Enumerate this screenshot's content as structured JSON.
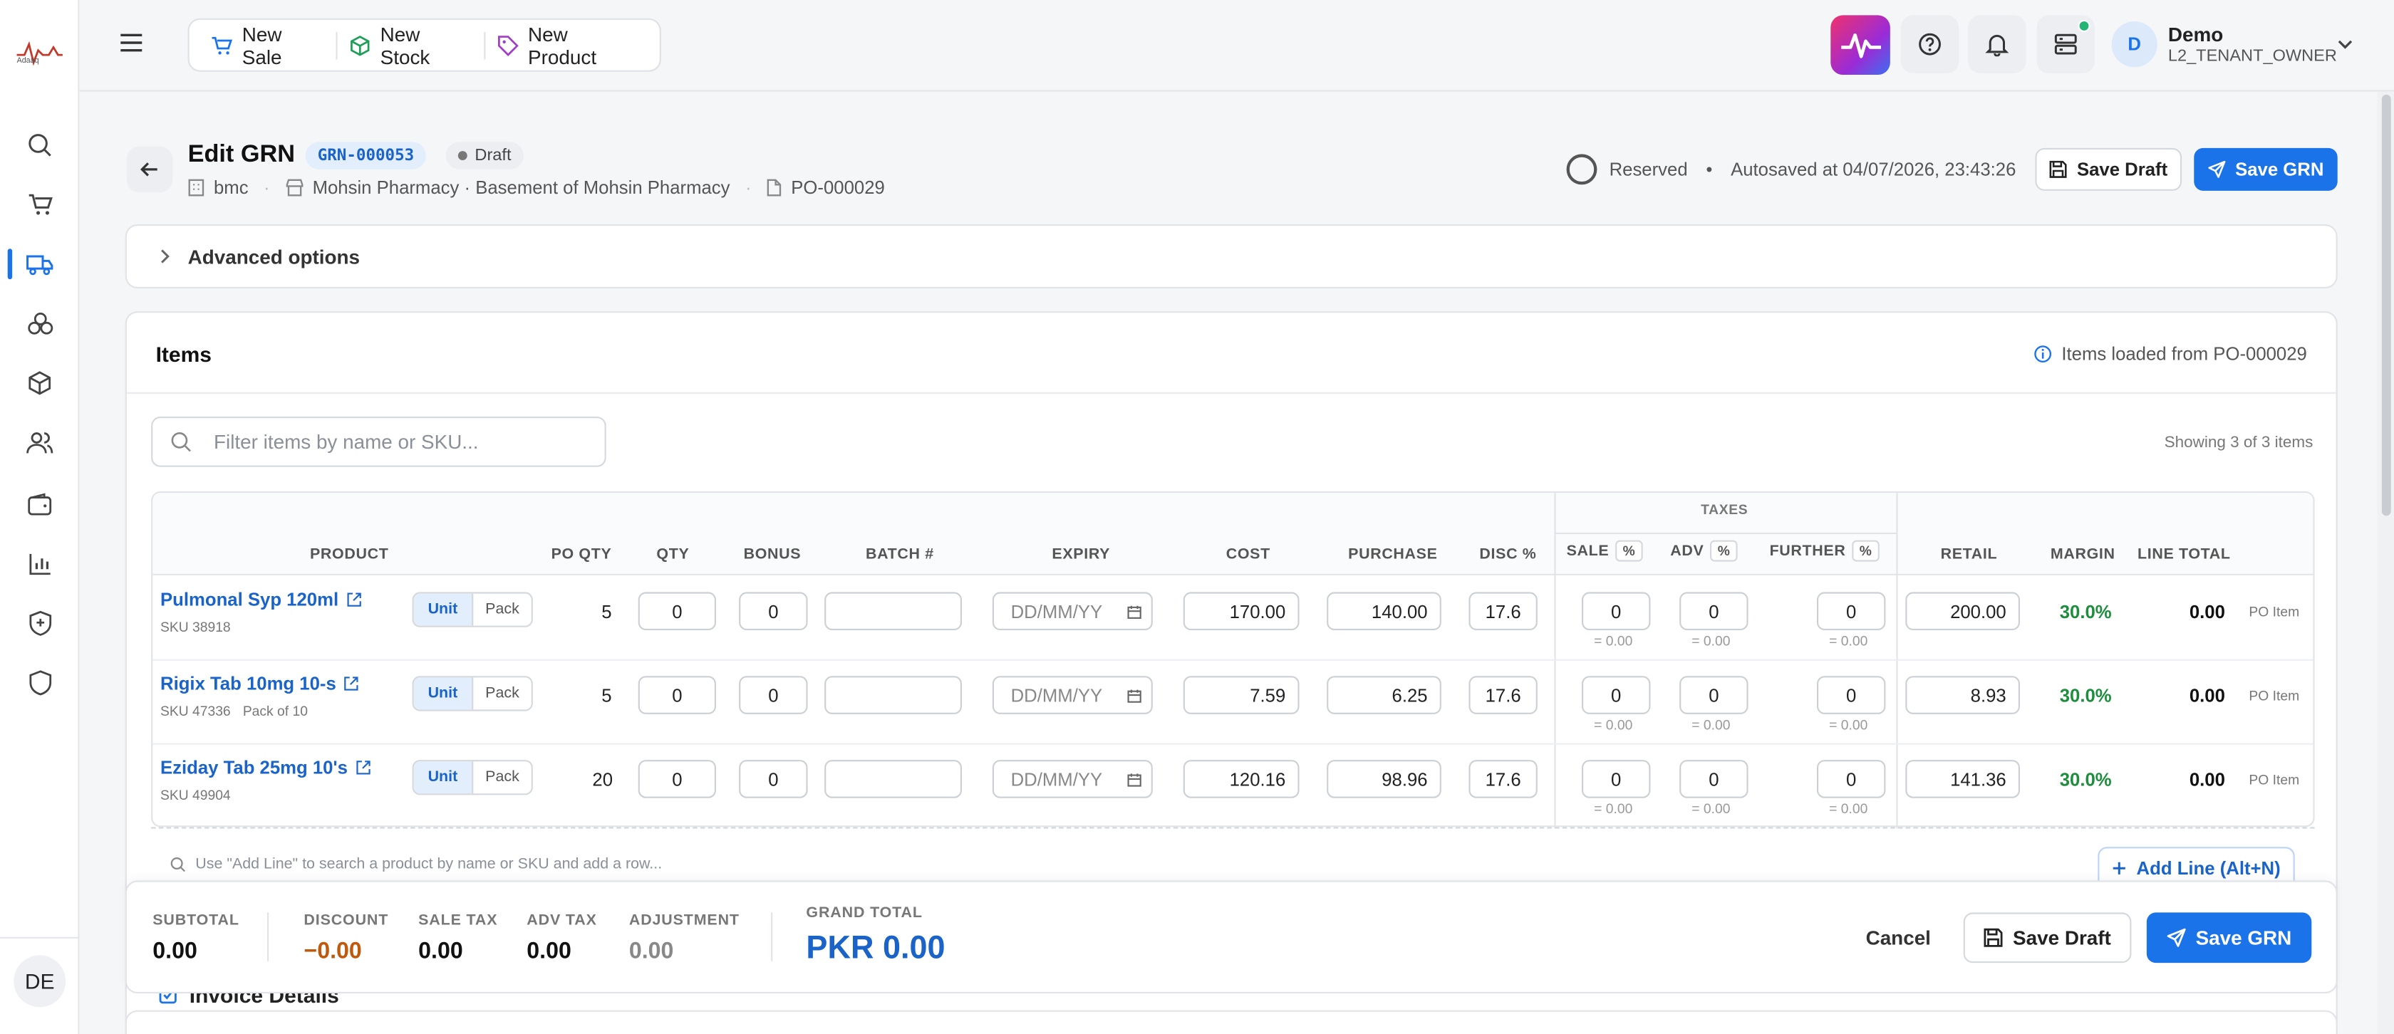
{
  "app": {
    "logo_text": "Adaaq"
  },
  "topbar": {
    "quick_actions": [
      {
        "label": "New Sale",
        "icon": "cart-icon"
      },
      {
        "label": "New Stock",
        "icon": "box-plus-icon"
      },
      {
        "label": "New Product",
        "icon": "tag-icon"
      }
    ],
    "user": {
      "initial": "D",
      "name": "Demo",
      "role": "L2_TENANT_OWNER"
    }
  },
  "sidebar": {
    "items": [
      "search",
      "sales",
      "purchases",
      "inventory",
      "products",
      "customers",
      "wallet",
      "reports",
      "security",
      "shield"
    ],
    "avatar": "DE"
  },
  "header": {
    "title": "Edit GRN",
    "grn_number": "GRN-000053",
    "status": "Draft",
    "branch": "bmc",
    "location": "Mohsin Pharmacy · Basement of Mohsin Pharmacy",
    "po_ref": "PO-000029",
    "reserved": "Reserved",
    "autosave": "Autosaved at 04/07/2026, 23:43:26",
    "save_draft": "Save Draft",
    "save_grn": "Save GRN"
  },
  "advanced": {
    "label": "Advanced options"
  },
  "items": {
    "title": "Items",
    "loaded_from": "Items loaded from PO-000029",
    "filter_placeholder": "Filter items by name or SKU...",
    "showing": "Showing 3 of 3 items",
    "columns": {
      "product": "PRODUCT",
      "po_qty": "PO QTY",
      "qty": "QTY",
      "bonus": "BONUS",
      "batch": "BATCH #",
      "expiry": "EXPIRY",
      "cost": "COST",
      "purchase": "PURCHASE",
      "disc": "DISC %",
      "taxes": "TAXES",
      "sale": "SALE",
      "adv": "ADV",
      "further": "FURTHER",
      "pct": "%",
      "retail": "RETAIL",
      "margin": "MARGIN",
      "line_total": "LINE TOTAL"
    },
    "unit_label": "Unit",
    "pack_label": "Pack",
    "expiry_placeholder": "DD/MM/YY",
    "rows": [
      {
        "name": "Pulmonal Syp 120ml",
        "sku": "SKU  38918",
        "pack": "",
        "po_qty": "5",
        "qty": "0",
        "bonus": "0",
        "cost": "170.00",
        "purchase": "140.00",
        "disc": "17.6",
        "sale": "0",
        "sale_sub": "= 0.00",
        "adv": "0",
        "adv_sub": "= 0.00",
        "further": "0",
        "further_sub": "= 0.00",
        "retail": "200.00",
        "margin": "30.0%",
        "line_total": "0.00",
        "source": "PO Item"
      },
      {
        "name": "Rigix Tab 10mg 10-s",
        "sku": "SKU  47336",
        "pack": "Pack of 10",
        "po_qty": "5",
        "qty": "0",
        "bonus": "0",
        "cost": "7.59",
        "purchase": "6.25",
        "disc": "17.6",
        "sale": "0",
        "sale_sub": "= 0.00",
        "adv": "0",
        "adv_sub": "= 0.00",
        "further": "0",
        "further_sub": "= 0.00",
        "retail": "8.93",
        "margin": "30.0%",
        "line_total": "0.00",
        "source": "PO Item"
      },
      {
        "name": "Eziday Tab 25mg 10's",
        "sku": "SKU  49904",
        "pack": "",
        "po_qty": "20",
        "qty": "0",
        "bonus": "0",
        "cost": "120.16",
        "purchase": "98.96",
        "disc": "17.6",
        "sale": "0",
        "sale_sub": "= 0.00",
        "adv": "0",
        "adv_sub": "= 0.00",
        "further": "0",
        "further_sub": "= 0.00",
        "retail": "141.36",
        "margin": "30.0%",
        "line_total": "0.00",
        "source": "PO Item"
      }
    ],
    "add_hint": "Use \"Add Line\" to search a product by name or SKU and add a row...",
    "add_line": "Add Line (Alt+N)"
  },
  "footer": {
    "subtotal_label": "SUBTOTAL",
    "subtotal": "0.00",
    "discount_label": "DISCOUNT",
    "discount": "−0.00",
    "sale_tax_label": "SALE TAX",
    "sale_tax": "0.00",
    "adv_tax_label": "ADV TAX",
    "adv_tax": "0.00",
    "adjustment_label": "ADJUSTMENT",
    "adjustment": "0.00",
    "grand_total_label": "GRAND TOTAL",
    "grand_total": "PKR 0.00",
    "cancel": "Cancel",
    "save_draft": "Save Draft",
    "save_grn": "Save GRN"
  },
  "invoice": {
    "label": "Invoice Details"
  },
  "colors": {
    "primary": "#1a73e8",
    "margin_green": "#1e8e3e",
    "discount_orange": "#c0590c"
  }
}
